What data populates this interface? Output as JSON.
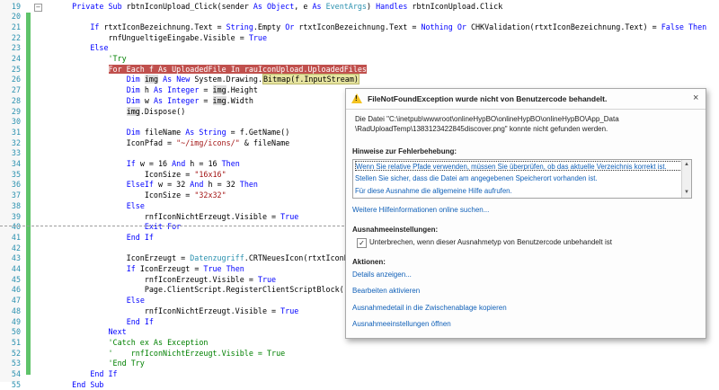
{
  "editor": {
    "lines": [
      {
        "num": "19",
        "fold": "minus",
        "html": "    <span class=\"kw\">Private Sub</span> rbtnIconUpload_Click(sender <span class=\"kw\">As</span> <span class=\"kw\">Object</span>, e <span class=\"kw\">As</span> <span class=\"ty\">EventArgs</span>) <span class=\"kw\">Handles</span> rbtnIconUpload.Click"
      },
      {
        "num": "20",
        "html": ""
      },
      {
        "num": "21",
        "html": "        <span class=\"kw\">If</span> rtxtIconBezeichnung.Text = <span class=\"kw\">String</span>.Empty <span class=\"kw\">Or</span> rtxtIconBezeichnung.Text = <span class=\"kw\">Nothing</span> <span class=\"kw\">Or</span> CHKValidation(rtxtIconBezeichnung.Text) = <span class=\"kw\">False Then</span>"
      },
      {
        "num": "22",
        "html": "            rnfUngueltigeEingabe.Visible = <span class=\"kw\">True</span>"
      },
      {
        "num": "23",
        "html": "        <span class=\"kw\">Else</span>"
      },
      {
        "num": "24",
        "html": "            <span class=\"cm\">'Try</span>"
      },
      {
        "num": "25",
        "html": "            <span class=\"hl-stmt\"><span class=\"kw\">For Each</span> f <span class=\"kw\">As</span> UploadedFile <span class=\"kw\">In</span> rauIconUpload.UploadedFiles</span>"
      },
      {
        "num": "26",
        "html": "                <span class=\"kw\">Dim</span> <span class=\"hl-img\">img</span> <span class=\"kw\">As New</span> System.Drawing.<span class=\"hl-cur\">Bitmap(f.InputStream)</span>"
      },
      {
        "num": "27",
        "html": "                <span class=\"kw\">Dim</span> h <span class=\"kw\">As Integer</span> = <span class=\"hl-img\">img</span>.Height"
      },
      {
        "num": "28",
        "html": "                <span class=\"kw\">Dim</span> w <span class=\"kw\">As Integer</span> = <span class=\"hl-img\">img</span>.Width"
      },
      {
        "num": "29",
        "html": "                <span class=\"hl-img\">img</span>.Dispose()"
      },
      {
        "num": "30",
        "html": ""
      },
      {
        "num": "31",
        "html": "                <span class=\"kw\">Dim</span> fileName <span class=\"kw\">As String</span> = f.GetName()"
      },
      {
        "num": "32",
        "html": "                IconPfad = <span class=\"st\">\"~/img/icons/\"</span> &amp; fileName"
      },
      {
        "num": "33",
        "html": ""
      },
      {
        "num": "34",
        "html": "                <span class=\"kw\">If</span> w = 16 <span class=\"kw\">And</span> h = 16 <span class=\"kw\">Then</span>"
      },
      {
        "num": "35",
        "html": "                    IconSize = <span class=\"st\">\"16x16\"</span>"
      },
      {
        "num": "36",
        "html": "                <span class=\"kw\">ElseIf</span> w = 32 <span class=\"kw\">And</span> h = 32 <span class=\"kw\">Then</span>"
      },
      {
        "num": "37",
        "html": "                    IconSize = <span class=\"st\">\"32x32\"</span>"
      },
      {
        "num": "38",
        "html": "                <span class=\"kw\">Else</span>"
      },
      {
        "num": "39",
        "html": "                    rnfIconNichtErzeugt.Visible = <span class=\"kw\">True</span>"
      },
      {
        "num": "40",
        "html": "                    <span class=\"kw\">Exit For</span>"
      },
      {
        "num": "41",
        "html": "                <span class=\"kw\">End If</span>"
      },
      {
        "num": "42",
        "html": ""
      },
      {
        "num": "43",
        "html": "                IconErzeugt = <span class=\"ty\">Datenzugriff</span>.CRTNeuesIcon(rtxtIconBezei"
      },
      {
        "num": "44",
        "html": "                <span class=\"kw\">If</span> IconErzeugt = <span class=\"kw\">True Then</span>"
      },
      {
        "num": "45",
        "html": "                    rnfIconErzeugt.Visible = <span class=\"kw\">True</span>"
      },
      {
        "num": "46",
        "html": "                    Page.ClientScript.RegisterClientScriptBlock([GetT"
      },
      {
        "num": "47",
        "html": "                <span class=\"kw\">Else</span>"
      },
      {
        "num": "48",
        "html": "                    rnfIconNichtErzeugt.Visible = <span class=\"kw\">True</span>"
      },
      {
        "num": "49",
        "html": "                <span class=\"kw\">End If</span>"
      },
      {
        "num": "50",
        "html": "            <span class=\"kw\">Next</span>"
      },
      {
        "num": "51",
        "html": "            <span class=\"cm\">'Catch ex As Exception</span>"
      },
      {
        "num": "52",
        "html": "            <span class=\"cm\">'    rnfIconNichtErzeugt.Visible = True</span>"
      },
      {
        "num": "53",
        "html": "            <span class=\"cm\">'End Try</span>"
      },
      {
        "num": "54",
        "html": "        <span class=\"kw\">End If</span>"
      },
      {
        "num": "55",
        "html": "    <span class=\"kw\">End Sub</span>"
      }
    ]
  },
  "popup": {
    "title": "FileNotFoundException wurde nicht von Benutzercode behandelt.",
    "close_glyph": "×",
    "warning_glyph": "!",
    "message_line1": "Die Datei \"C:\\inetpub\\wwwroot\\onlineHypBO\\onlineHypBO\\onlineHypBO\\App_Data",
    "message_line2": "\\RadUploadTemp\\1383123422845discover.png\" konnte nicht gefunden werden.",
    "troubleshooting_heading": "Hinweise zur Fehlerbehebung:",
    "tips": [
      "Wenn Sie relative Pfade verwenden, müssen Sie überprüfen, ob das aktuelle Verzeichnis korrekt ist.",
      "Stellen Sie sicher, dass die Datei am angegebenen Speicherort vorhanden ist.",
      "Für diese Ausnahme die allgemeine Hilfe aufrufen."
    ],
    "more_help_link": "Weitere Hilfeinformationen online suchen...",
    "exception_settings_heading": "Ausnahmeeinstellungen:",
    "break_checkbox_label": "Unterbrechen, wenn dieser Ausnahmetyp von Benutzercode unbehandelt ist",
    "break_checked": true,
    "actions_heading": "Aktionen:",
    "actions": [
      "Details anzeigen...",
      "Bearbeiten aktivieren",
      "Ausnahmedetail in die Zwischenablage kopieren",
      "Ausnahmeeinstellungen öffnen"
    ]
  },
  "colors": {
    "statement_highlight": "#c0504d",
    "current_expr_highlight": "#e6e4a0",
    "change_bar": "#5fc36a",
    "warning_icon": "#f4c321",
    "link": "#1060b8"
  }
}
